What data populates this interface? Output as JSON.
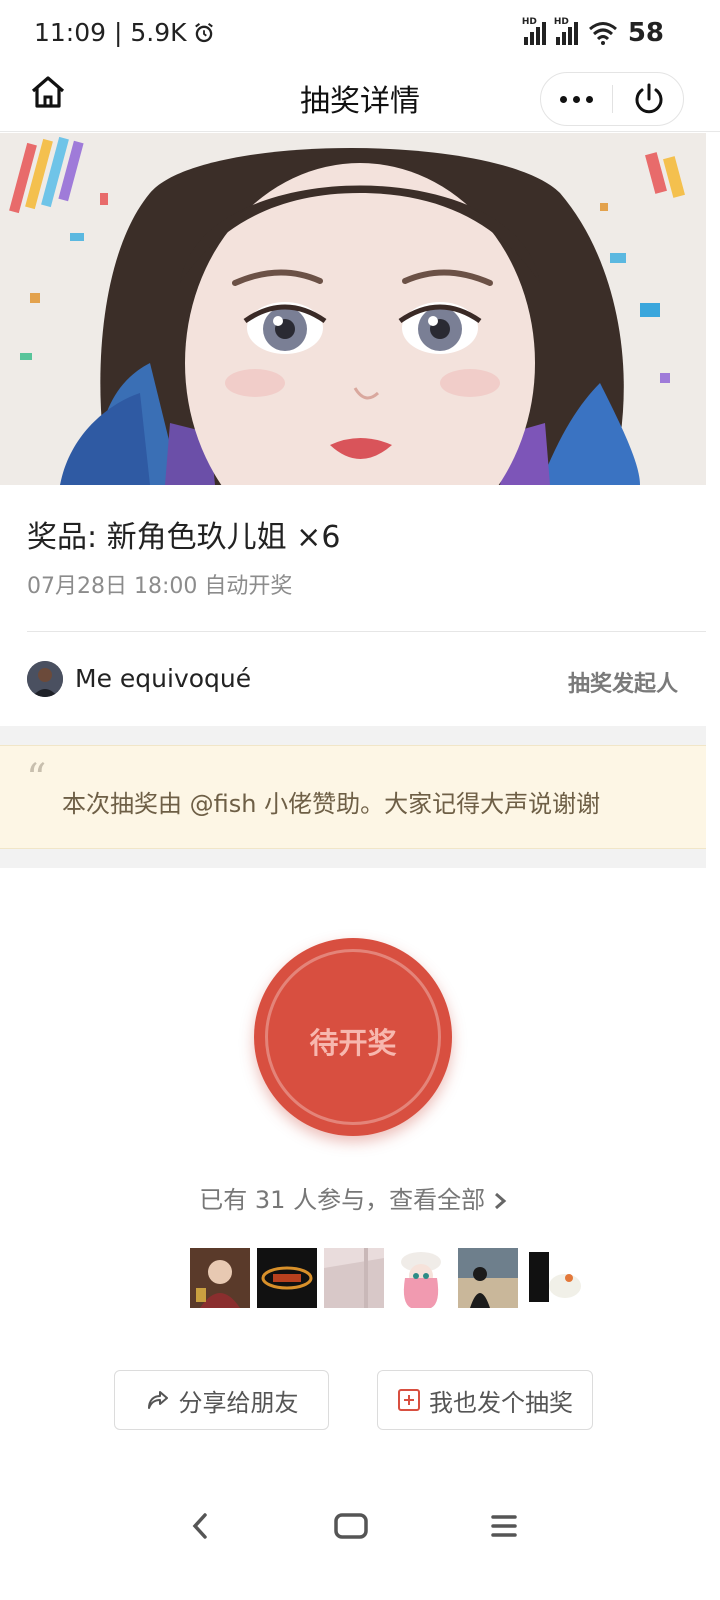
{
  "status_bar": {
    "time_text": "11:09 | 5.9K",
    "battery": "58",
    "hd_label": "HD"
  },
  "nav": {
    "title": "抽奖详情"
  },
  "prize": {
    "title": "奖品: 新角色玖儿姐 ×6",
    "draw_time": "07月28日 18:00 自动开奖"
  },
  "sponsor": {
    "name": "Me equivoqué",
    "role": "抽奖发起人"
  },
  "quote": {
    "mark": "“",
    "text": "本次抽奖由 @fish 小佬赞助。大家记得大声说谢谢"
  },
  "draw_button": {
    "label": "待开奖"
  },
  "participants": {
    "text": "已有 31 人参与，查看全部"
  },
  "actions": {
    "share_label": "分享给朋友",
    "create_label": "我也发个抽奖"
  },
  "colors": {
    "accent_red": "#d84f40",
    "quote_bg": "#fdf6e5"
  }
}
